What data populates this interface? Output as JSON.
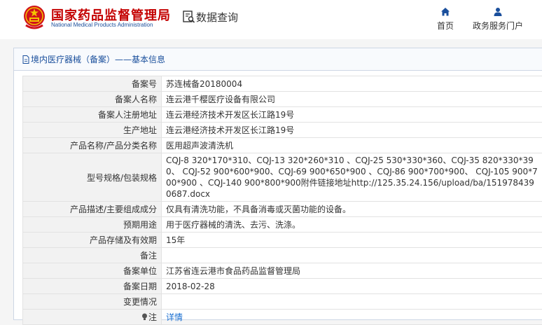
{
  "header": {
    "brand_cn": "国家药品监督管理局",
    "brand_en": "National Medical Products Administration",
    "search_label": "数据查询",
    "nav": {
      "home": "首页",
      "portal": "政务服务门户"
    }
  },
  "panel": {
    "title": "境内医疗器械（备案）——基本信息"
  },
  "rows": [
    {
      "key": "备案号",
      "value": "苏连械备20180004"
    },
    {
      "key": "备案人名称",
      "value": "连云港千樱医疗设备有限公司"
    },
    {
      "key": "备案人注册地址",
      "value": "连云港经济技术开发区长江路19号"
    },
    {
      "key": "生产地址",
      "value": "连云港经济技术开发区长江路19号"
    },
    {
      "key": "产品名称/产品分类名称",
      "value": "医用超声波清洗机"
    },
    {
      "key": "型号规格/包装规格",
      "value": "CQJ-8 320*170*310、CQJ-13 320*260*310 、CQJ-25 530*330*360、CQJ-35 820*330*390、 CQJ-52 900*600*900、CQJ-69 900*650*900 、CQJ-86 900*700*900、 CQJ-105 900*700*900 、CQJ-140 900*800*900附件链接地址http://125.35.24.156/upload/ba/1519784390687.docx"
    },
    {
      "key": "产品描述/主要组成成分",
      "value": "仅具有清洗功能，不具备消毒或灭菌功能的设备。"
    },
    {
      "key": "预期用途",
      "value": "用于医疗器械的清洗、去污、洗涤。"
    },
    {
      "key": "产品存储及有效期",
      "value": "15年"
    },
    {
      "key": "备注",
      "value": ""
    },
    {
      "key": "备案单位",
      "value": "江苏省连云港市食品药品监督管理局"
    },
    {
      "key": "备案日期",
      "value": "2018-02-28"
    },
    {
      "key": "变更情况",
      "value": ""
    },
    {
      "key": "注",
      "value": "详情"
    }
  ],
  "colors": {
    "brand_red": "#c40000",
    "brand_blue": "#1a4f9c",
    "link": "#1a6fd1"
  },
  "icons": {
    "logo": "national-emblem-icon",
    "search": "search-document-icon",
    "home": "home-icon",
    "portal": "user-icon",
    "title": "document-icon",
    "note": "bulb-icon"
  }
}
